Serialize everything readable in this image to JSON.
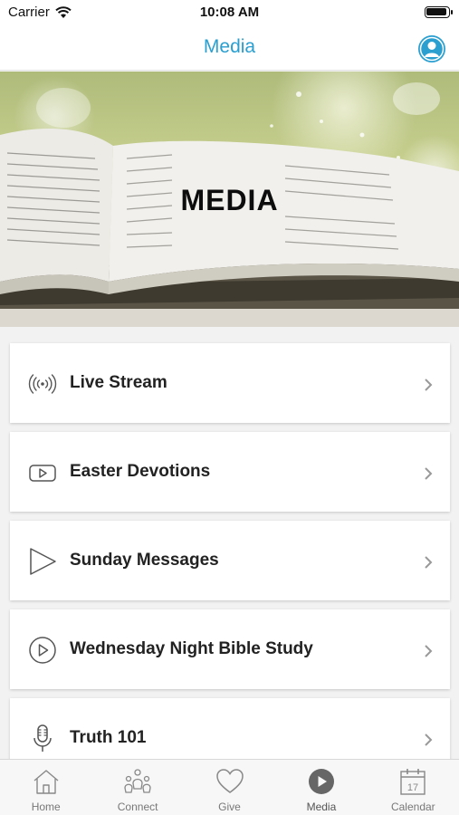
{
  "status_bar": {
    "carrier": "Carrier",
    "time": "10:08 AM"
  },
  "nav": {
    "title": "Media",
    "profile_icon": "user-icon"
  },
  "hero": {
    "title": "MEDIA"
  },
  "items": [
    {
      "label": "Live Stream",
      "icon": "broadcast-icon"
    },
    {
      "label": "Easter Devotions",
      "icon": "youtube-icon"
    },
    {
      "label": "Sunday Messages",
      "icon": "play-triangle-icon"
    },
    {
      "label": "Wednesday Night Bible Study",
      "icon": "play-circle-icon"
    },
    {
      "label": "Truth 101",
      "icon": "microphone-icon"
    }
  ],
  "tabs": [
    {
      "label": "Home",
      "icon": "home-icon",
      "active": false
    },
    {
      "label": "Connect",
      "icon": "people-icon",
      "active": false
    },
    {
      "label": "Give",
      "icon": "heart-icon",
      "active": false
    },
    {
      "label": "Media",
      "icon": "play-circle-icon",
      "active": true
    },
    {
      "label": "Calendar",
      "icon": "calendar-icon",
      "active": false
    }
  ],
  "calendar_day": "17",
  "colors": {
    "accent": "#2a9fd0",
    "card_text": "#222222",
    "tab_text": "#777777"
  }
}
